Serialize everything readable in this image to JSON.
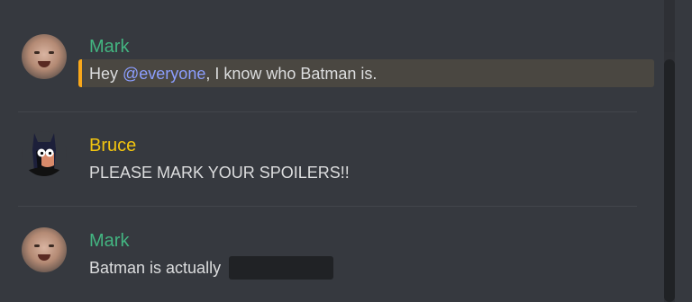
{
  "colors": {
    "background": "#36393f",
    "mark_name": "#43b581",
    "bruce_name": "#f1c40f",
    "mention_text": "#8c9eff",
    "mention_bar": "#faa81a",
    "mention_bg": "#4a4741",
    "spoiler": "#202225"
  },
  "messages": [
    {
      "author": "Mark",
      "avatar_icon": "user-avatar-photo",
      "prefix": "Hey ",
      "mention": "@everyone",
      "suffix": ", I know who Batman is."
    },
    {
      "author": "Bruce",
      "avatar_icon": "batman-cartoon-avatar",
      "text": "PLEASE MARK YOUR SPOILERS!!"
    },
    {
      "author": "Mark",
      "avatar_icon": "user-avatar-photo",
      "text": "Batman is actually ",
      "spoiler_hidden": true
    }
  ]
}
